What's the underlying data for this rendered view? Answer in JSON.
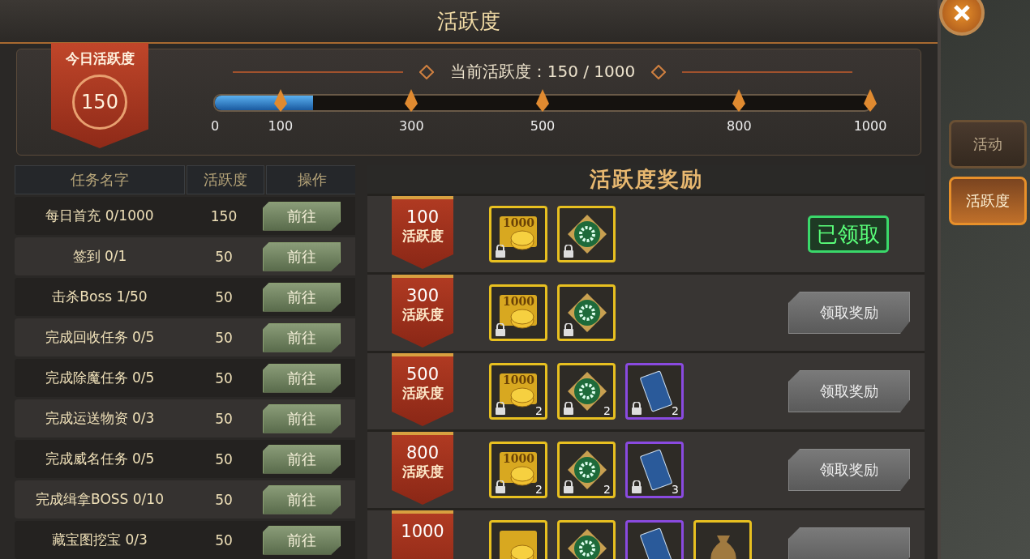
{
  "window": {
    "title": "活跃度"
  },
  "today": {
    "label": "今日活跃度",
    "value": "150"
  },
  "progress": {
    "caption": "当前活跃度：150 / 1000",
    "level": 0.15,
    "ticks": [
      "0",
      "100",
      "300",
      "500",
      "800",
      "1000"
    ]
  },
  "tasks": {
    "columns": [
      "任务名字",
      "活跃度",
      "操作"
    ],
    "rows": [
      {
        "name": "每日首充 0/1000",
        "points": "150",
        "action": "前往"
      },
      {
        "name": "签到 0/1",
        "points": "50",
        "action": "前往"
      },
      {
        "name": "击杀Boss 1/50",
        "points": "50",
        "action": "前往"
      },
      {
        "name": "完成回收任务 0/5",
        "points": "50",
        "action": "前往"
      },
      {
        "name": "完成除魔任务 0/5",
        "points": "50",
        "action": "前往"
      },
      {
        "name": "完成运送物资 0/3",
        "points": "50",
        "action": "前往"
      },
      {
        "name": "完成威名任务 0/5",
        "points": "50",
        "action": "前往"
      },
      {
        "name": "完成缉拿BOSS 0/10",
        "points": "50",
        "action": "前往"
      },
      {
        "name": "藏宝图挖宝 0/3",
        "points": "50",
        "action": "前往"
      }
    ]
  },
  "rewards": {
    "title": "活跃度奖励",
    "rows": [
      {
        "threshold": "100",
        "unit": "活跃度",
        "claimed": true,
        "button": "已领取",
        "items": [
          {
            "kind": "coin",
            "label": "1000"
          },
          {
            "kind": "chip"
          }
        ]
      },
      {
        "threshold": "300",
        "unit": "活跃度",
        "claimed": false,
        "button": "领取奖励",
        "items": [
          {
            "kind": "coin",
            "label": "1000"
          },
          {
            "kind": "chip"
          }
        ]
      },
      {
        "threshold": "500",
        "unit": "活跃度",
        "claimed": false,
        "button": "领取奖励",
        "items": [
          {
            "kind": "coin",
            "label": "1000",
            "count": "2"
          },
          {
            "kind": "chip",
            "count": "2"
          },
          {
            "kind": "pass",
            "count": "2"
          }
        ]
      },
      {
        "threshold": "800",
        "unit": "活跃度",
        "claimed": false,
        "button": "领取奖励",
        "items": [
          {
            "kind": "coin",
            "label": "1000",
            "count": "2"
          },
          {
            "kind": "chip",
            "count": "2"
          },
          {
            "kind": "pass",
            "count": "3"
          }
        ]
      },
      {
        "threshold": "1000",
        "claimed": false,
        "items": [
          {
            "kind": "coin"
          },
          {
            "kind": "chip"
          },
          {
            "kind": "pass"
          },
          {
            "kind": "bag"
          }
        ]
      }
    ]
  },
  "side_tabs": [
    {
      "label": "活动",
      "selected": false
    },
    {
      "label": "活跃度",
      "selected": true
    }
  ]
}
